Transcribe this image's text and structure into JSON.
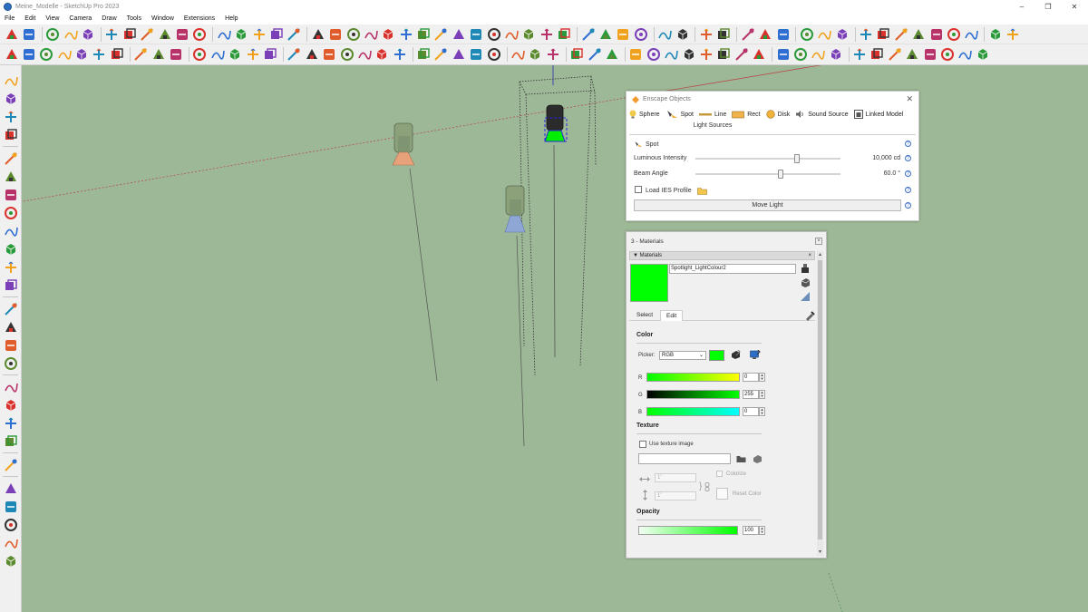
{
  "window": {
    "title": "Meine_Modelle - SketchUp Pro 2023",
    "minimize": "–",
    "maximize": "❐",
    "close": "✕"
  },
  "menu": [
    "File",
    "Edit",
    "View",
    "Camera",
    "Draw",
    "Tools",
    "Window",
    "Extensions",
    "Help"
  ],
  "toolbar_row1_icons": [
    "components-icon",
    "eraser-icon",
    "paint-bucket-icon",
    "mesh-icon",
    "shapes-icon",
    "select-icon",
    "pushpull-icon",
    "move-icon",
    "scale-icon",
    "arrow-up-down-icon",
    "arrow-down-icon",
    "line-icon",
    "flip-icon",
    "undo-icon",
    "redo-icon",
    "stamp-icon",
    "arc-icon",
    "zigzag-icon",
    "freehand-icon",
    "curve-icon",
    "circle-icon",
    "polygon-icon",
    "offset-icon",
    "spiral-icon",
    "bezier-icon",
    "loop-icon",
    "arc2-icon",
    "polyline-icon",
    "wave-icon",
    "octagon-icon",
    "halfcircle-icon",
    "wrench-icon",
    "ring-icon",
    "knot-icon",
    "cube-red-icon",
    "cube-blue-icon",
    "cube-white-icon",
    "target-icon",
    "pencil-icon",
    "transfer-icon",
    "document-icon",
    "compare-icon",
    "sun-icon",
    "render-icon",
    "warehouse-icon",
    "scissors-icon",
    "eyeglasses-icon",
    "bird-icon",
    "tree-icon",
    "car-icon",
    "mountain-icon",
    "eye-icon",
    "rainbow-icon",
    "drop-icon"
  ],
  "toolbar_row2_icons": [
    "view-iso-icon",
    "view-top-icon",
    "view-front-icon",
    "view-right-icon",
    "view-back-icon",
    "view-left-icon",
    "view-bottom-icon",
    "book-icon",
    "layers-icon",
    "formula-icon",
    "cube-small-icon",
    "z-axis-icon",
    "gradient-icon",
    "brush-icon",
    "wand-icon",
    "box-a-icon",
    "box-b-icon",
    "box-c-icon",
    "box-d-icon",
    "box-e-icon",
    "box-f-icon",
    "box-g-icon",
    "house-orange-icon",
    "house-green-icon",
    "house-blue-icon",
    "house-purple-icon",
    "rotate-house-icon",
    "settings-gear-icon",
    "gear-flower-icon",
    "cross-arrows-icon",
    "enscape-logo-icon",
    "refresh-icon",
    "pause-icon",
    "add-icon",
    "tree-black-icon",
    "pyramid-icon",
    "checker-icon",
    "cloud-upload-icon",
    "gears-icon",
    "mail-icon",
    "info-icon",
    "person-icon",
    "spot-light-icon",
    "bulb-icon",
    "star-icon",
    "path-a-icon",
    "path-b-icon",
    "path-c-icon",
    "path-d-icon",
    "path-e-icon",
    "path-f-icon",
    "path-g-icon",
    "eraser-path-icon"
  ],
  "left_tools": [
    "wand-icon",
    "shapes-icon",
    "label-icon",
    "axes-icon",
    "freehand-curve-icon",
    "rect-select-icon",
    "circle-icon",
    "arc-icon",
    "curve-icon",
    "spiral-icon",
    "node-icon",
    "protractor-icon",
    "zoom-icon",
    "zoom-extents-icon",
    "zoom-window-icon",
    "walk-icon",
    "eye-icon",
    "position-icon",
    "orbit-icon",
    "pan-icon",
    "section-icon",
    "layers-icon",
    "copy-icon",
    "stack-icon",
    "page-icon",
    "compass-icon"
  ],
  "enscape": {
    "title": "Enscape Objects",
    "types": [
      {
        "label": "Sphere",
        "icon": "bulb-icon"
      },
      {
        "label": "Spot",
        "icon": "spot-icon"
      },
      {
        "label": "Line",
        "icon": "line-light-icon"
      },
      {
        "label": "Rect",
        "icon": "rect-light-icon"
      },
      {
        "label": "Disk",
        "icon": "disk-light-icon"
      },
      {
        "label": "Sound Source",
        "icon": "speaker-icon"
      },
      {
        "label": "Linked Model",
        "icon": "linked-model-icon"
      }
    ],
    "section": "Light Sources",
    "selected_type": "Spot",
    "luminous_label": "Luminous Intensity",
    "luminous_value": "10,000 cd",
    "luminous_level": 0.7,
    "beam_label": "Beam Angle",
    "beam_value": "60.0 °",
    "beam_level": 0.59,
    "ies_label": "Load IES Profile",
    "move_light": "Move Light",
    "help": "?"
  },
  "materials": {
    "title": "3 - Materials",
    "tray": "Materials",
    "tray_close": "×",
    "name": "Spotlight_LightColour2",
    "swatch": "#00ff00",
    "tabs": [
      "Select",
      "Edit"
    ],
    "active_tab": "Edit",
    "color_section": "Color",
    "picker_label": "Picker:",
    "picker_value": "RGB",
    "r_label": "R",
    "r_value": "0",
    "g_label": "G",
    "g_value": "255",
    "b_label": "B",
    "b_value": "0",
    "texture_section": "Texture",
    "use_texture": "Use texture image",
    "colorize": "Colorize",
    "reset_color": "Reset Color",
    "dim_w": "1'",
    "dim_h": "1'",
    "opacity_section": "Opacity",
    "opacity_value": "100"
  }
}
